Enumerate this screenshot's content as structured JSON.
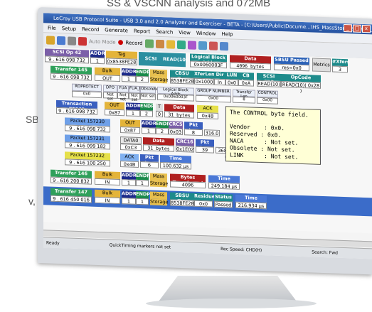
{
  "caption": "SS & VSCNN analysis and 072MB",
  "side_text": {
    "a": "SB",
    "b": "v,"
  },
  "window": {
    "title": "LeCroy USB Protocol Suite - USB 3.0 and 2.0 Analyzer and Exerciser - BETA - [C:\\Users\\Public\\Docume...\\HS_MassStorage_Enum_And_Reads.usb]"
  },
  "menu": [
    "File",
    "Setup",
    "Record",
    "Generate",
    "Report",
    "Search",
    "View",
    "Window",
    "Help"
  ],
  "toolbar": {
    "auto_mode": "Auto Mode",
    "record": "Record"
  },
  "row1": {
    "label": "SCSI Op 42",
    "time": "9 . 616 098 732",
    "addr_l": "ADDR",
    "addr": "1",
    "tag_l": "Tag",
    "tag": "0x8538FE28",
    "cdb_l": "SCSI CDB",
    "cdb": "READ(10)",
    "lba_l": "Logical Block Addr",
    "lba": "0x0060003F",
    "data_l": "Data",
    "data": "4096 bytes",
    "sbsu_l": "SBSU Passed",
    "sbsu": "res=0x0",
    "metrics": "Metrics",
    "xfers_l": "#Xfers",
    "xfers": "3"
  },
  "row2": {
    "label": "Transfer 145",
    "time": "9 . 616 098 732",
    "bulk_l": "Bulk",
    "bulk": "OUT",
    "addr_l": "ADDR",
    "addr": "1",
    "endp_l": "ENDP",
    "endp": "2",
    "mass": "Mass",
    "storage": "Storage",
    "cbsu_l": "CBSU Tag",
    "cbsu": "8538FE28",
    "xfer_l": "XferLen",
    "xfer": "0x1000",
    "dir_l": "Dir",
    "dir": "In",
    "lun_l": "LUN",
    "lun": "0x0",
    "cblen_l": "CB Len",
    "cblen": "0xA",
    "scsi_l": "SCSI CDB",
    "scsi": "READ(10)",
    "op_l": "OpCode",
    "op": "READ(10)( 0x28 )"
  },
  "row3": {
    "h": [
      "RDPROTECT",
      "DPO",
      "FUA",
      "FUA_NV",
      "Obsolete",
      "Logical Block Addr",
      "GROUP NUMBER",
      "Transfer Len",
      "CONTROL"
    ],
    "v": [
      "0x0",
      "Not set",
      "Not set",
      "Not set",
      "Not set",
      "0x0060003F",
      "0x00",
      "8",
      "0x00"
    ]
  },
  "row4": {
    "label": "Transaction 72962",
    "time": "9 . 616 098 732",
    "out_l": "OUT",
    "out": "0x87",
    "addr_l": "ADDR",
    "addr": "1",
    "endp_l": "ENDP",
    "endp": "2",
    "t_l": "T",
    "t": "0",
    "data_l": "Data",
    "data": "31 bytes",
    "ack": "ACK",
    "ackv": "0x4B"
  },
  "row5": {
    "label": "Packet 157230",
    "time": "9 . 616 098 732",
    "out_l": "OUT",
    "out": "0x87",
    "addr_l": "ADDR",
    "addr": "1",
    "endp_l": "ENDP",
    "endp": "2",
    "crc5_l": "CRC5",
    "crc5": "0x03",
    "pkt_l": "Pkt Len",
    "pkt": "8",
    "dur": "316.0"
  },
  "row6": {
    "label": "Packet 157231",
    "time": "9 . 616 099 182",
    "d0_l": "DATA0",
    "d0": "0xC3",
    "data_l": "Data",
    "data": "31 bytes",
    "crc16_l": "CRC16",
    "crc16": "0x1E02",
    "pkt_l": "Pkt Len",
    "pkt": "39",
    "dur": "368.000 ns"
  },
  "row7": {
    "label": "Packet 157232",
    "time": "9 . 616 100 250",
    "ack_l": "ACK",
    "ack": "0x4B",
    "pkt_l": "Pkt Len",
    "pkt": "6",
    "time_l": "Time",
    "tval": "100.632 µs"
  },
  "row8": {
    "label": "Transfer 146",
    "time": "9 . 616 200 832",
    "bulk_l": "Bulk",
    "bulk": "IN",
    "addr_l": "ADDR",
    "addr": "1",
    "endp_l": "ENDP",
    "endp": "1",
    "mass": "Mass",
    "storage": "Storage",
    "bt_l": "Bytes Transferred",
    "bt": "4096",
    "time_l": "Time",
    "tval": "249.184 µs"
  },
  "row9": {
    "label": "Transfer 147",
    "time": "9 . 616 450 016",
    "bulk_l": "Bulk",
    "bulk": "IN",
    "addr_l": "ADDR",
    "addr": "1",
    "endp_l": "ENDP",
    "endp": "1",
    "mass": "Mass",
    "storage": "Storage",
    "tag_l": "SBSU Tag",
    "tag": "8538FE28",
    "res_l": "Residue",
    "res": "0x0",
    "st_l": "Status",
    "st": "Passed",
    "time_l": "Time",
    "tval": "216.934 µs"
  },
  "tooltip": "The CONTROL byte field.\n\nVendor    : 0x0.\nReserved : 0x0.\nNACA      : Not set.\nObsolete : Not set.\nLINK      : Not set.",
  "status": {
    "ready": "Ready",
    "qt": "QuickTiming markers not set",
    "rec": "Rec Speed: CHD(H)",
    "search": "Search: Fwd"
  }
}
